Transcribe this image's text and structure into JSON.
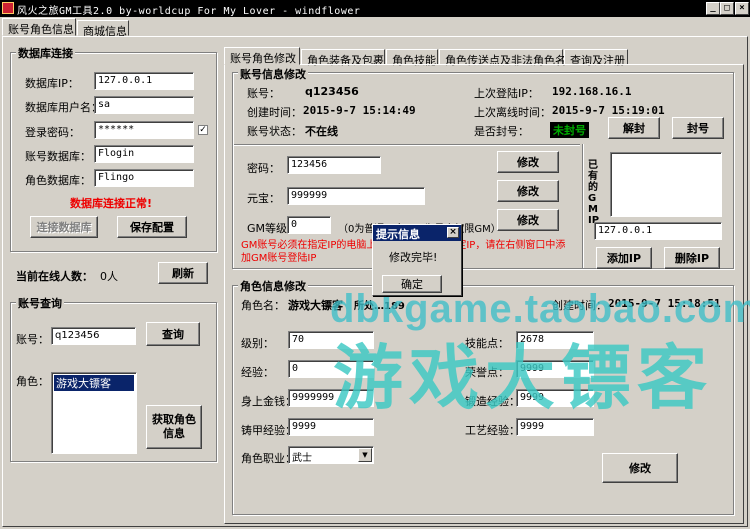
{
  "window": {
    "title": "风火之旅GM工具2.0  by-worldcup For My Lover - windflower",
    "min": "_",
    "max": "□",
    "close": "×"
  },
  "top_tabs": [
    "账号角色信息",
    "商城信息"
  ],
  "db": {
    "group_title": "数据库连接",
    "ip_label": "数据库IP：",
    "ip_value": "127.0.0.1",
    "user_label": "数据库用户名：",
    "user_value": "sa",
    "pwd_label": "登录密码：",
    "pwd_value": "******",
    "acc_db_label": "账号数据库：",
    "acc_db_value": "Flogin",
    "role_db_label": "角色数据库：",
    "role_db_value": "Flingo",
    "status": "数据库连接正常!",
    "connect_btn": "连接数据库",
    "save_btn": "保存配置"
  },
  "online": {
    "label": "当前在线人数：",
    "value": "0人",
    "refresh_btn": "刷新"
  },
  "query": {
    "group_title": "账号查询",
    "account_label": "账号：",
    "account_value": "q123456",
    "query_btn": "查询",
    "role_label": "角色：",
    "roles": [
      "游戏大镖客"
    ],
    "get_role_btn": "获取角色\n信息"
  },
  "right_tabs": [
    "账号角色修改",
    "角色装备及包裹",
    "角色技能",
    "角色传送点及非法角色名",
    "查询及注册"
  ],
  "account_info": {
    "group_title": "账号信息修改",
    "account_label": "账号：",
    "account_value": "q123456",
    "last_ip_label": "上次登陆IP：",
    "last_ip_value": "192.168.16.1",
    "created_label": "创建时间：",
    "created_value": "2015-9-7 15:14:49",
    "last_logout_label": "上次离线时间：",
    "last_logout_value": "2015-9-7 15:19:01",
    "status_label": "账号状态：",
    "status_value": "不在线",
    "banned_label": "是否封号：",
    "banned_value": "未封号",
    "unban_btn": "解封",
    "ban_btn": "封号",
    "pwd_label": "密码：",
    "pwd_value": "123456",
    "gold_label": "元宝：",
    "gold_value": "999999",
    "gm_label": "GM等级：",
    "gm_value": "0",
    "gm_hint": "（0为普通玩家，…为最高权限GM）",
    "modify_btn": "修改",
    "warning": "GM账号必须在指定IP的电脑上登陆，如果没有指定IP，请在右侧窗口中添加GM账号登陆IP",
    "ip_list_label": "已有的GM IP",
    "ip_input_value": "127.0.0.1",
    "add_ip_btn": "添加IP",
    "del_ip_btn": "删除IP"
  },
  "role_info": {
    "group_title": "角色信息修改",
    "name_label": "角色名：",
    "name_value": "游戏大镖客",
    "account_partial": "所处…189",
    "created_label": "创建时间：",
    "created_value": "2015-9-7 15:18:51",
    "level_label": "级别：",
    "level_value": "70",
    "skill_pts_label": "技能点：",
    "skill_pts_value": "2678",
    "exp_label": "经验：",
    "exp_value": "0",
    "honor_label": "荣誉点：",
    "honor_value": "9999",
    "money_label": "身上金钱：",
    "money_value": "9999999",
    "craft_label": "锻造经验：",
    "craft_value": "9999",
    "armor_label": "铸甲经验：",
    "armor_value": "9999",
    "tech_label": "工艺经验：",
    "tech_value": "9999",
    "job_label": "角色职业：",
    "job_value": "武士",
    "modify_btn": "修改"
  },
  "dialog": {
    "title": "提示信息",
    "message": "修改完毕!",
    "ok_btn": "确定",
    "close": "×"
  },
  "watermark": {
    "line1": "dbkgame.taobao.com",
    "line2": "游戏大镖客"
  }
}
